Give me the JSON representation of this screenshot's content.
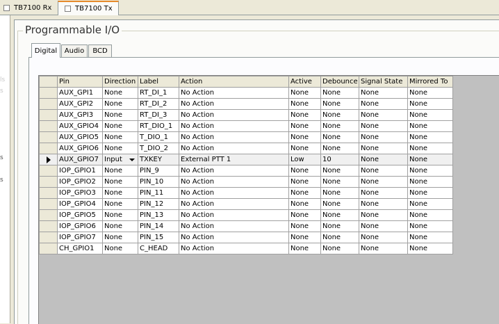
{
  "doc_tabs": [
    {
      "label": "TB7100 Rx"
    },
    {
      "label": "TB7100 Tx"
    }
  ],
  "left_panel": {
    "fragments": [
      "ls",
      "s",
      "s",
      "s"
    ]
  },
  "section": {
    "title": "Programmable I/O",
    "tabs": [
      {
        "label": "Digital"
      },
      {
        "label": "Audio"
      },
      {
        "label": "BCD"
      }
    ]
  },
  "grid": {
    "columns": [
      "Pin",
      "Direction",
      "Label",
      "Action",
      "Active",
      "Debounce",
      "Signal State",
      "Mirrored To"
    ],
    "rows": [
      [
        "AUX_GPI1",
        "None",
        "RT_DI_1",
        "No Action",
        "None",
        "None",
        "None",
        "None"
      ],
      [
        "AUX_GPI2",
        "None",
        "RT_DI_2",
        "No Action",
        "None",
        "None",
        "None",
        "None"
      ],
      [
        "AUX_GPI3",
        "None",
        "RT_DI_3",
        "No Action",
        "None",
        "None",
        "None",
        "None"
      ],
      [
        "AUX_GPIO4",
        "None",
        "RT_DIO_1",
        "No Action",
        "None",
        "None",
        "None",
        "None"
      ],
      [
        "AUX_GPIO5",
        "None",
        "T_DIO_1",
        "No Action",
        "None",
        "None",
        "None",
        "None"
      ],
      [
        "AUX_GPIO6",
        "None",
        "T_DIO_2",
        "No Action",
        "None",
        "None",
        "None",
        "None"
      ],
      [
        "AUX_GPIO7",
        "Input",
        "TXKEY",
        "External PTT 1",
        "Low",
        "10",
        "None",
        "None"
      ],
      [
        "IOP_GPIO1",
        "None",
        "PIN_9",
        "No Action",
        "None",
        "None",
        "None",
        "None"
      ],
      [
        "IOP_GPIO2",
        "None",
        "PIN_10",
        "No Action",
        "None",
        "None",
        "None",
        "None"
      ],
      [
        "IOP_GPIO3",
        "None",
        "PIN_11",
        "No Action",
        "None",
        "None",
        "None",
        "None"
      ],
      [
        "IOP_GPIO4",
        "None",
        "PIN_12",
        "No Action",
        "None",
        "None",
        "None",
        "None"
      ],
      [
        "IOP_GPIO5",
        "None",
        "PIN_13",
        "No Action",
        "None",
        "None",
        "None",
        "None"
      ],
      [
        "IOP_GPIO6",
        "None",
        "PIN_14",
        "No Action",
        "None",
        "None",
        "None",
        "None"
      ],
      [
        "IOP_GPIO7",
        "None",
        "PIN_15",
        "No Action",
        "None",
        "None",
        "None",
        "None"
      ],
      [
        "CH_GPIO1",
        "None",
        "C_HEAD",
        "No Action",
        "None",
        "None",
        "None",
        "None"
      ]
    ],
    "selected_row": 6
  }
}
